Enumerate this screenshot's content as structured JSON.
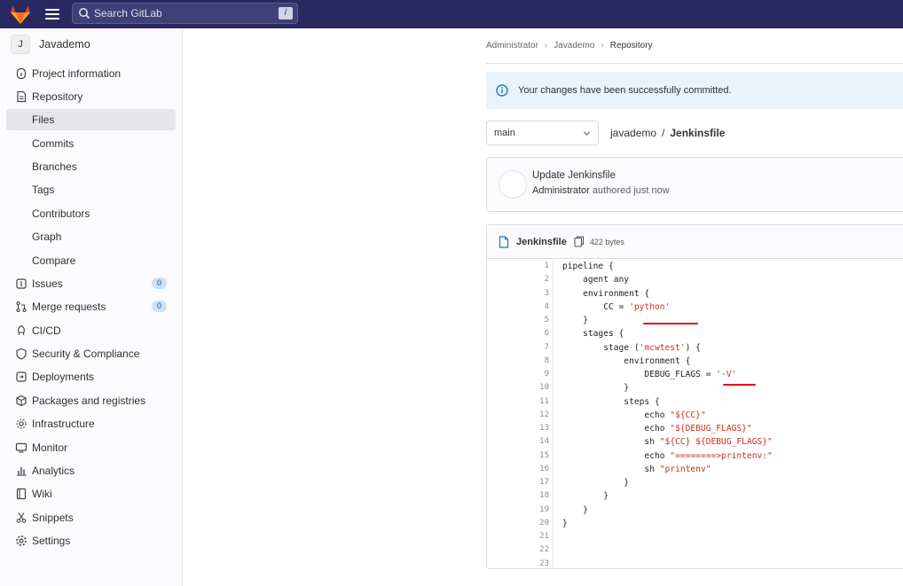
{
  "topbar": {
    "search_placeholder": "Search GitLab",
    "shortcut": "/"
  },
  "sidebar": {
    "project_initial": "J",
    "project_name": "Javademo",
    "items": [
      {
        "label": "Project information",
        "icon": "info-icon"
      },
      {
        "label": "Repository",
        "icon": "repository-icon"
      },
      {
        "label": "Files",
        "sub": true,
        "active": true
      },
      {
        "label": "Commits",
        "sub": true
      },
      {
        "label": "Branches",
        "sub": true
      },
      {
        "label": "Tags",
        "sub": true
      },
      {
        "label": "Contributors",
        "sub": true
      },
      {
        "label": "Graph",
        "sub": true
      },
      {
        "label": "Compare",
        "sub": true
      },
      {
        "label": "Issues",
        "icon": "issues-icon",
        "badge": "0"
      },
      {
        "label": "Merge requests",
        "icon": "merge-request-icon",
        "badge": "0"
      },
      {
        "label": "CI/CD",
        "icon": "rocket-icon"
      },
      {
        "label": "Security & Compliance",
        "icon": "shield-icon"
      },
      {
        "label": "Deployments",
        "icon": "deployments-icon"
      },
      {
        "label": "Packages and registries",
        "icon": "package-icon"
      },
      {
        "label": "Infrastructure",
        "icon": "cloud-gear-icon"
      },
      {
        "label": "Monitor",
        "icon": "monitor-icon"
      },
      {
        "label": "Analytics",
        "icon": "chart-icon"
      },
      {
        "label": "Wiki",
        "icon": "book-icon"
      },
      {
        "label": "Snippets",
        "icon": "scissors-icon"
      },
      {
        "label": "Settings",
        "icon": "settings-icon"
      }
    ]
  },
  "breadcrumb": [
    "Administrator",
    "Javademo",
    "Repository"
  ],
  "alert": "Your changes have been successfully committed.",
  "branch": "main",
  "file_path": {
    "dir": "javademo",
    "sep": "/",
    "file": "Jenkinsfile"
  },
  "commit": {
    "title": "Update Jenkinsfile",
    "author": "Administrator",
    "meta": "authored just now"
  },
  "file": {
    "name": "Jenkinsfile",
    "size": "422 bytes",
    "lines": [
      "pipeline {",
      "    agent any",
      "    environment {",
      "        CC = 'python'",
      "    }",
      "    stages {",
      "        stage ('mcwtest') {",
      "            environment {",
      "                DEBUG_FLAGS = '-V'",
      "            }",
      "            steps {",
      "                echo \"${CC}\"",
      "                echo \"${DEBUG_FLAGS}\"",
      "                sh \"${CC} ${DEBUG_FLAGS}\"",
      "                echo \"========>printenv:\"",
      "                sh \"printenv\"",
      "            }",
      "        }",
      "    }",
      "}",
      "",
      "",
      ""
    ]
  }
}
